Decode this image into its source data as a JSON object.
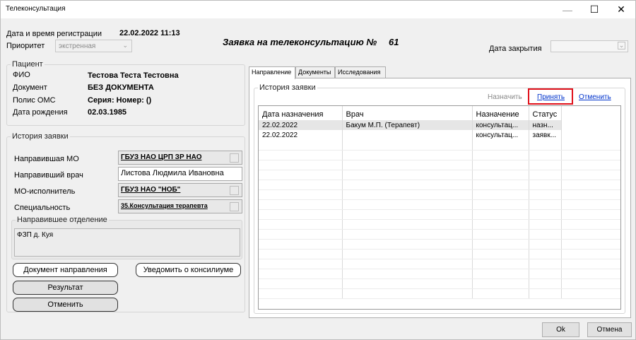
{
  "window": {
    "title": "Телеконсультация",
    "min_glyph": "—",
    "max_glyph": "☐",
    "close_glyph": "✕"
  },
  "header": {
    "reg_label": "Дата и время регистрации",
    "reg_value": "22.02.2022 11:13",
    "priority_label": "Приоритет",
    "priority_value": "экстренная",
    "request_title": "Заявка на телеконсультацию №",
    "request_number": "61",
    "close_date_label": "Дата закрытия",
    "close_date_value": ""
  },
  "patient": {
    "legend": "Пациент",
    "fio_label": "ФИО",
    "fio_value": "Тестова Теста Тестовна",
    "doc_label": "Документ",
    "doc_value": "БЕЗ ДОКУМЕНТА",
    "oms_label": "Полис ОМС",
    "oms_value": "Серия: Номер: ()",
    "dob_label": "Дата рождения",
    "dob_value": "02.03.1985"
  },
  "history": {
    "legend": "История заявки",
    "ref_mo_label": "Направившая МО",
    "ref_mo_value": "ГБУЗ НАО ЦРП ЗР НАО",
    "ref_doctor_label": "Направивший врач",
    "ref_doctor_value": "Листова Людмила Ивановна",
    "exec_mo_label": "МО-исполнитель",
    "exec_mo_value": "ГБУЗ НАО \"НОБ\"",
    "specialty_label": "Специальность",
    "specialty_value": "35.Консультация терапевта",
    "dept_legend": "Направившее отделение",
    "dept_value": "ФЗП д. Куя"
  },
  "buttons": {
    "ref_document": "Документ направления",
    "notify": "Уведомить о консилиуме",
    "result": "Результат",
    "cancel": "Отменить",
    "ok": "Ok",
    "footer_cancel": "Отмена"
  },
  "tabs": [
    {
      "label": "Направление"
    },
    {
      "label": "Документы"
    },
    {
      "label": "Исследования"
    }
  ],
  "history_panel": {
    "legend": "История заявки",
    "action_assign": "Назначить",
    "action_accept": "Принять",
    "action_cancel": "Отменить",
    "columns": [
      "Дата назначения",
      "Врач",
      "Назначение",
      "Статус"
    ],
    "rows": [
      [
        "22.02.2022",
        "Бакум М.П. (Терапевт)",
        "консультац...",
        "назн..."
      ],
      [
        "22.02.2022",
        "",
        "консультац...",
        "заявк..."
      ]
    ]
  },
  "colors": {
    "highlight": "#e0101a",
    "link": "#0033cc"
  }
}
